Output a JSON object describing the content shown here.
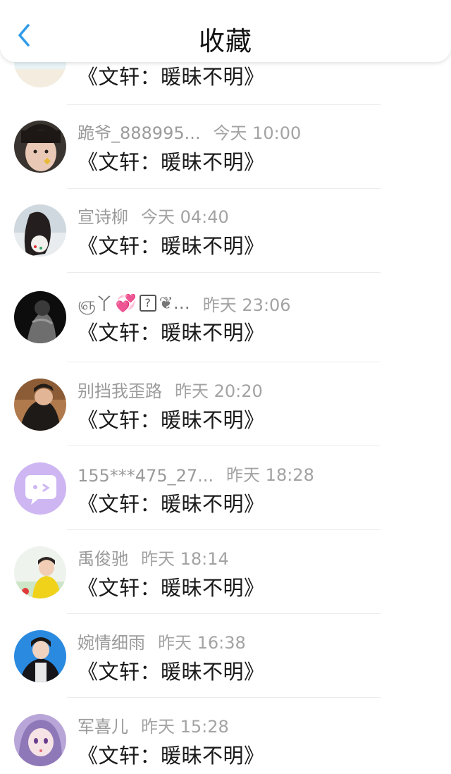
{
  "header": {
    "title": "收藏"
  },
  "items": [
    {
      "avatar": "beach-avatar",
      "name": "",
      "time": "",
      "message": "《文轩：暖昧不明》"
    },
    {
      "avatar": "girl-selfie-avatar",
      "name": "跪爷_888995...",
      "time": "今天 10:00",
      "message": "《文轩：暖昧不明》"
    },
    {
      "avatar": "girl-long-hair-avatar",
      "name": "宣诗柳",
      "time": "今天 04:40",
      "message": "《文轩：暖昧不明》"
    },
    {
      "avatar": "dark-figure-avatar",
      "name": "ஞ丫💞?❦…",
      "name_parts": [
        "ஞ丫",
        "💞",
        "?",
        "❦…"
      ],
      "time": "昨天 23:06",
      "message": "《文轩：暖昧不明》"
    },
    {
      "avatar": "boy-looking-up-avatar",
      "name": "别挡我歪路",
      "time": "昨天 20:20",
      "message": "《文轩：暖昧不明》"
    },
    {
      "avatar": "default-chat-avatar",
      "name": "155***475_27...",
      "time": "昨天 18:28",
      "message": "《文轩：暖昧不明》"
    },
    {
      "avatar": "boy-yellow-shirt-avatar",
      "name": "禹俊驰",
      "time": "昨天 18:14",
      "message": "《文轩：暖昧不明》"
    },
    {
      "avatar": "boy-dark-jacket-avatar",
      "name": "婉情细雨",
      "time": "昨天 16:38",
      "message": "《文轩：暖昧不明》"
    },
    {
      "avatar": "anime-girl-avatar",
      "name": "军喜儿",
      "time": "昨天 15:28",
      "message": "《文轩：暖昧不明》"
    }
  ],
  "colors": {
    "back_arrow": "#2f9bea",
    "name_gray": "#9b9b9b",
    "message_black": "#1a1a1a",
    "default_avatar_purple": "#cdb6f2"
  }
}
